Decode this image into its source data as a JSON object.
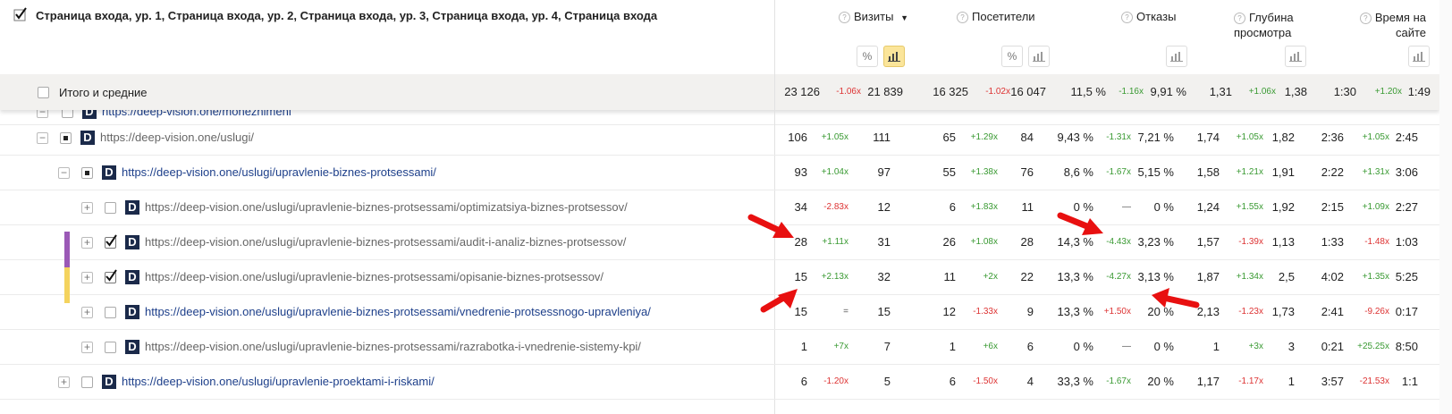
{
  "header": {
    "title": "Страница входа, ур. 1, Страница входа, ур. 2, Страница входа, ур. 3, Страница входа, ур. 4, Страница входа",
    "col_visits": "Визиты",
    "col_visits_sort": "▼",
    "col_visitors": "Посетители",
    "col_bounces": "Отказы",
    "col_depth_1": "Глубина",
    "col_depth_2": "просмотра",
    "col_time_1": "Время на",
    "col_time_2": "сайте",
    "help_glyph": "?"
  },
  "colors": {
    "accent_purple": "#9b59b6",
    "accent_yellow": "#f4d35e",
    "arrow_red": "#e81010"
  },
  "totals": {
    "label": "Итого и средние",
    "visits": "23 126",
    "visits_delta": "-1.06x",
    "visits_prev": "21 839",
    "visitors": "16 325",
    "visitors_delta": "-1.02x",
    "visitors_prev": "16 047",
    "bounce": "11,5 %",
    "bounce_delta": "-1.16x",
    "bounce_prev": "9,91 %",
    "depth": "1,31",
    "depth_delta": "+1.06x",
    "depth_prev": "1,38",
    "time": "1:30",
    "time_delta": "+1.20x",
    "time_prev": "1:49"
  },
  "partial_row_url": "https://deep-vision.one/moneznimeni",
  "rows": [
    {
      "url": "https://deep-vision.one/uslugi/",
      "v": "106",
      "vd": "+1.05x",
      "vp": "111",
      "u": "65",
      "ud": "+1.29x",
      "up": "84",
      "b": "9,43 %",
      "bd": "-1.31x",
      "bp": "7,21 %",
      "d": "1,74",
      "dd": "+1.05x",
      "dp": "1,82",
      "t": "2:36",
      "td": "+1.05x",
      "tp": "2:45"
    },
    {
      "url": "https://deep-vision.one/uslugi/upravlenie-biznes-protsessami/",
      "v": "93",
      "vd": "+1.04x",
      "vp": "97",
      "u": "55",
      "ud": "+1.38x",
      "up": "76",
      "b": "8,6 %",
      "bd": "-1.67x",
      "bp": "5,15 %",
      "d": "1,58",
      "dd": "+1.21x",
      "dp": "1,91",
      "t": "2:22",
      "td": "+1.31x",
      "tp": "3:06"
    },
    {
      "url": "https://deep-vision.one/uslugi/upravlenie-biznes-protsessami/optimizatsiya-biznes-protsessov/",
      "v": "34",
      "vd": "-2.83x",
      "vp": "12",
      "u": "6",
      "ud": "+1.83x",
      "up": "11",
      "b": "0 %",
      "bd": "—",
      "bp": "0 %",
      "d": "1,24",
      "dd": "+1.55x",
      "dp": "1,92",
      "t": "2:15",
      "td": "+1.09x",
      "tp": "2:27"
    },
    {
      "url": "https://deep-vision.one/uslugi/upravlenie-biznes-protsessami/audit-i-analiz-biznes-protsessov/",
      "v": "28",
      "vd": "+1.11x",
      "vp": "31",
      "u": "26",
      "ud": "+1.08x",
      "up": "28",
      "b": "14,3 %",
      "bd": "-4.43x",
      "bp": "3,23 %",
      "d": "1,57",
      "dd": "-1.39x",
      "dp": "1,13",
      "t": "1:33",
      "td": "-1.48x",
      "tp": "1:03"
    },
    {
      "url": "https://deep-vision.one/uslugi/upravlenie-biznes-protsessami/opisanie-biznes-protsessov/",
      "v": "15",
      "vd": "+2.13x",
      "vp": "32",
      "u": "11",
      "ud": "+2x",
      "up": "22",
      "b": "13,3 %",
      "bd": "-4.27x",
      "bp": "3,13 %",
      "d": "1,87",
      "dd": "+1.34x",
      "dp": "2,5",
      "t": "4:02",
      "td": "+1.35x",
      "tp": "5:25"
    },
    {
      "url": "https://deep-vision.one/uslugi/upravlenie-biznes-protsessami/vnedrenie-protsessnogo-upravleniya/",
      "v": "15",
      "vd": "=",
      "vp": "15",
      "u": "12",
      "ud": "-1.33x",
      "up": "9",
      "b": "13,3 %",
      "bd": "+1.50x",
      "bp": "20 %",
      "d": "2,13",
      "dd": "-1.23x",
      "dp": "1,73",
      "t": "2:41",
      "td": "-9.26x",
      "tp": "0:17"
    },
    {
      "url": "https://deep-vision.one/uslugi/upravlenie-biznes-protsessami/razrabotka-i-vnedrenie-sistemy-kpi/",
      "v": "1",
      "vd": "+7x",
      "vp": "7",
      "u": "1",
      "ud": "+6x",
      "up": "6",
      "b": "0 %",
      "bd": "—",
      "bp": "0 %",
      "d": "1",
      "dd": "+3x",
      "dp": "3",
      "t": "0:21",
      "td": "+25.25x",
      "tp": "8:50"
    },
    {
      "url": "https://deep-vision.one/uslugi/upravlenie-proektami-i-riskami/",
      "v": "6",
      "vd": "-1.20x",
      "vp": "5",
      "u": "6",
      "ud": "-1.50x",
      "up": "4",
      "b": "33,3 %",
      "bd": "-1.67x",
      "bp": "20 %",
      "d": "1,17",
      "dd": "-1.17x",
      "dp": "1",
      "t": "3:57",
      "td": "-21.53x",
      "tp": "1:1"
    }
  ]
}
